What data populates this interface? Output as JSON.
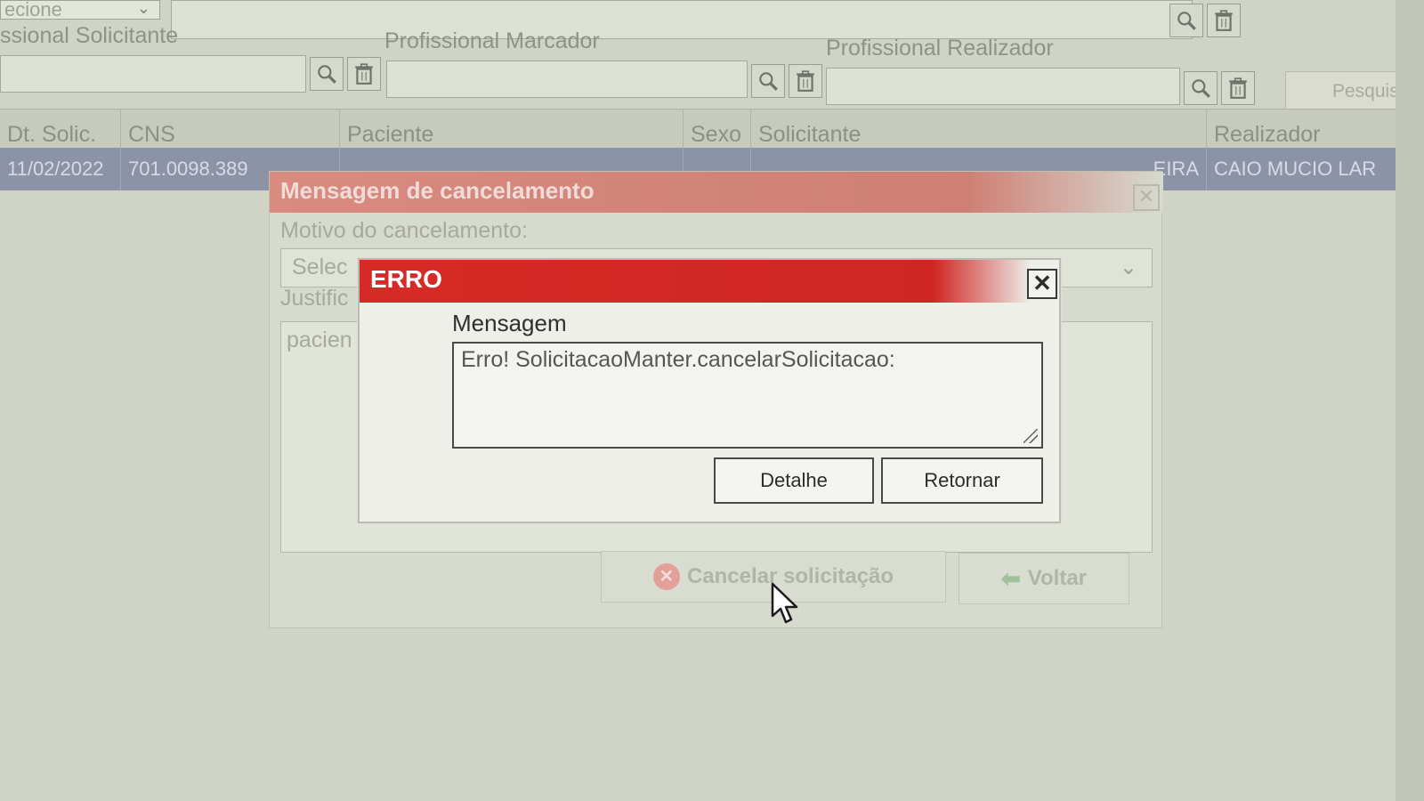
{
  "background": {
    "top_select_text": "ecione",
    "labels": {
      "solicitante": "ssional Solicitante",
      "marcador": "Profissional Marcador",
      "realizador": "Profissional Realizador"
    },
    "pesquisar_label": "Pesquisar",
    "table": {
      "headers": [
        "Dt. Solic.",
        "CNS",
        "Paciente",
        "Sexo",
        "Solicitante",
        "Realizador"
      ],
      "row": {
        "dt_solic": "11/02/2022",
        "cns": "701.0098.389",
        "solicitante_fragment": "EIRA",
        "realizador": "CAIO MUCIO LAR"
      }
    }
  },
  "cancel_dialog": {
    "title": "Mensagem de cancelamento",
    "motivo_label": "Motivo do cancelamento:",
    "motivo_placeholder": "Selec",
    "justificativa_label": "Justific",
    "justificativa_text": "pacien",
    "cancel_button": "Cancelar solicitação",
    "back_button": "Voltar"
  },
  "error_dialog": {
    "title": "ERRO",
    "close_glyph": "✕",
    "message_label": "Mensagem",
    "message_text": "Erro! SolicitacaoManter.cancelarSolicitacao:",
    "detail_button": "Detalhe",
    "return_button": "Retornar"
  },
  "colors": {
    "error_red": "#d72a26",
    "cancel_title_red": "#cf7f75",
    "selected_row": "#8d93a6"
  }
}
